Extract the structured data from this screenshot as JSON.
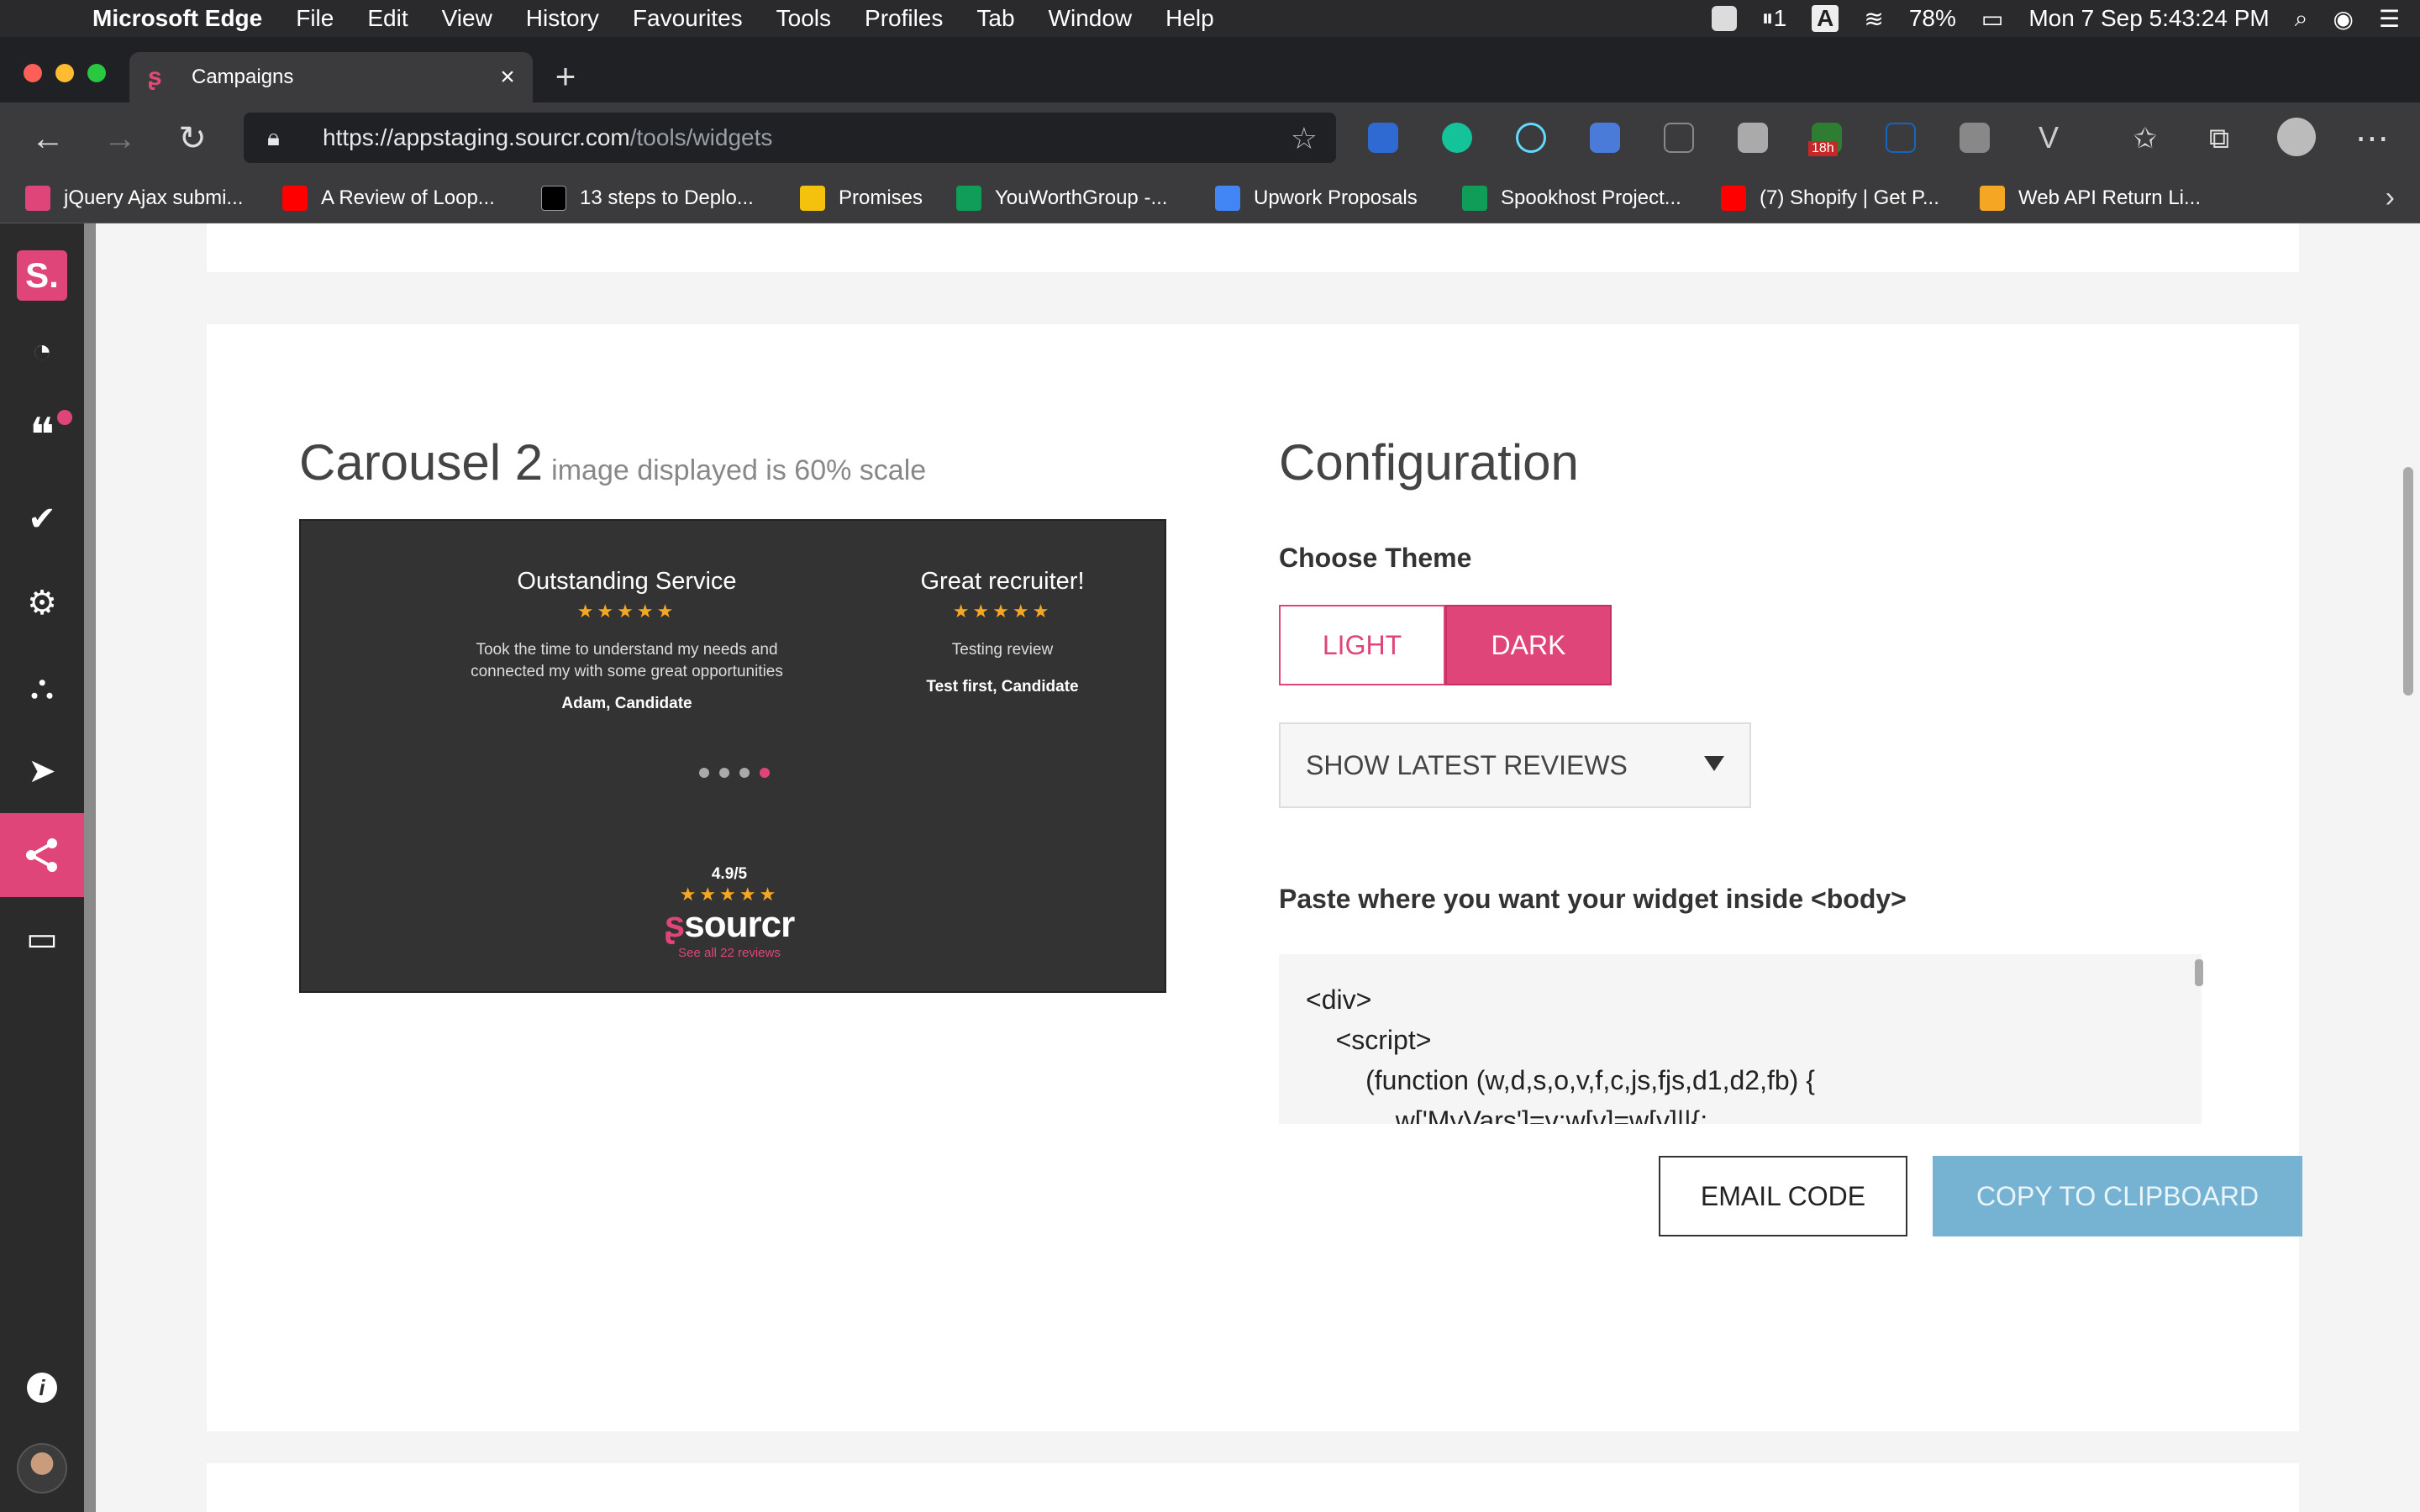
{
  "menubar": {
    "app_name": "Microsoft Edge",
    "items": [
      "File",
      "Edit",
      "View",
      "History",
      "Favourites",
      "Tools",
      "Profiles",
      "Tab",
      "Window",
      "Help"
    ],
    "pause_count": "1",
    "input_source": "A",
    "battery": "78%",
    "datetime": "Mon 7 Sep  5:43:24 PM"
  },
  "browser": {
    "tab_title": "Campaigns",
    "url_host": "https://appstaging.sourcr.com",
    "url_path": "/tools/widgets",
    "ext_badge": "18h",
    "bookmarks": [
      {
        "label": "jQuery Ajax submi...",
        "color": "#e0457a"
      },
      {
        "label": "A Review of Loop...",
        "color": "#ff0000"
      },
      {
        "label": "13 steps to Deplo...",
        "color": "#000000"
      },
      {
        "label": "Promises",
        "color": "#f4c20d"
      },
      {
        "label": "YouWorthGroup -...",
        "color": "#0f9d58"
      },
      {
        "label": "Upwork Proposals",
        "color": "#4285f4"
      },
      {
        "label": "Spookhost Project...",
        "color": "#0f9d58"
      },
      {
        "label": "(7) Shopify | Get P...",
        "color": "#ff0000"
      },
      {
        "label": "Web API Return Li...",
        "color": "#f5a623"
      }
    ]
  },
  "sidebar": {
    "logo": "S.",
    "items": [
      {
        "icon": "dashboard-icon",
        "glyph": "◔"
      },
      {
        "icon": "quote-icon",
        "glyph": "❝"
      },
      {
        "icon": "check-icon",
        "glyph": "✔"
      },
      {
        "icon": "gear-icon",
        "glyph": "⚙"
      },
      {
        "icon": "team-icon",
        "glyph": "⛬"
      },
      {
        "icon": "send-icon",
        "glyph": "➤"
      },
      {
        "icon": "share-icon",
        "glyph": "⋘"
      },
      {
        "icon": "card-icon",
        "glyph": "▭"
      }
    ],
    "info_glyph": "i",
    "accent": "#e0457a"
  },
  "widget": {
    "title": "Carousel 2",
    "subtitle": "image displayed is 60% scale",
    "preview": {
      "reviews": [
        {
          "title": "Outstanding Service",
          "stars": "★★★★★",
          "body_line1": "Took the time to understand my needs and",
          "body_line2": "connected my with some great opportunities",
          "author": "Adam, Candidate"
        },
        {
          "title": "Great recruiter!",
          "stars": "★★★★★",
          "body_line1": "Testing review",
          "body_line2": "",
          "author": "Test first, Candidate"
        }
      ],
      "score": "4.9/5",
      "stars": "★★★★★",
      "brand_mark": "ʂ",
      "brand": "sourcr",
      "see_all": "See all 22 reviews"
    }
  },
  "config": {
    "title": "Configuration",
    "theme_label": "Choose Theme",
    "theme_light": "LIGHT",
    "theme_dark": "DARK",
    "selected_theme": "DARK",
    "review_select": "SHOW LATEST REVIEWS",
    "paste_label": "Paste where you want your widget inside <body>",
    "code": "<div>\n    <script>\n        (function (w,d,s,o,v,f,c,js,fjs,d1,d2,fb) {\n            w['MyVars']=v;w[v]=w[v]||{;",
    "email_button": "EMAIL CODE",
    "copy_button": "COPY TO CLIPBOARD"
  }
}
